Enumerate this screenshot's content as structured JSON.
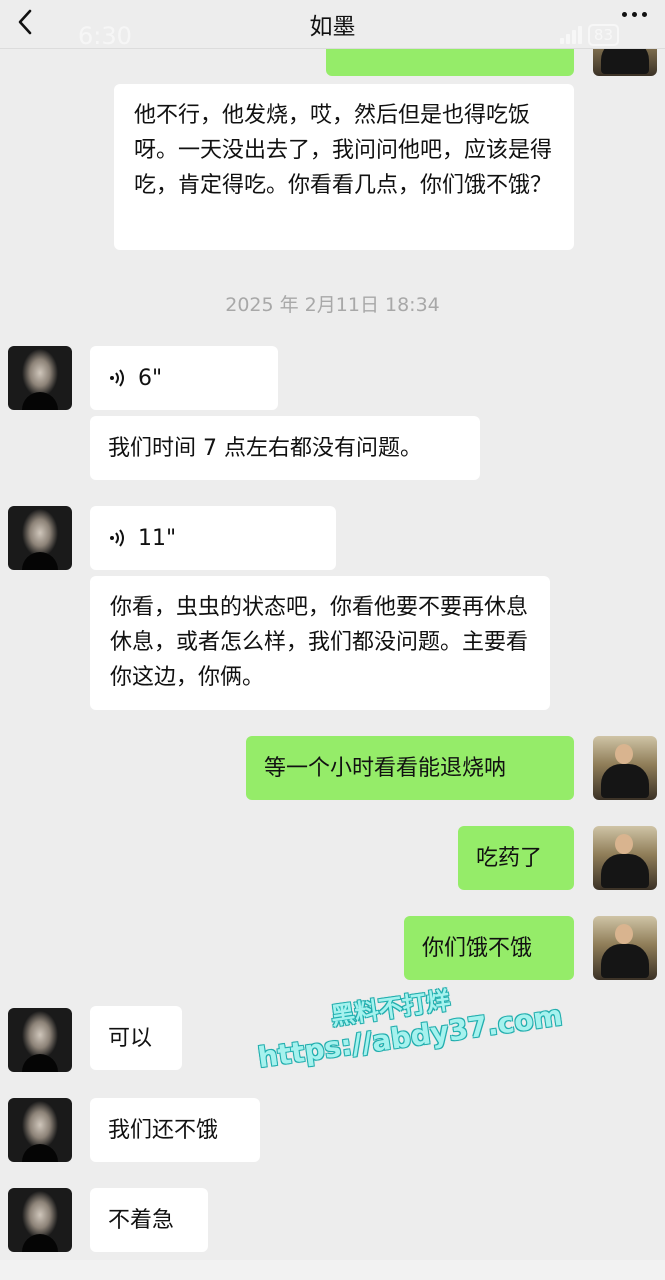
{
  "header": {
    "title": "如墨",
    "ghost_time": "6:30",
    "ghost_battery": "83"
  },
  "messages": {
    "m1": "他不行，他发烧，哎，然后但是也得吃饭呀。一天没出去了，我问问他吧，应该是得吃，肯定得吃。你看看几点，你们饿不饿？",
    "timestamp": "2025 年 2月11日 18:34",
    "voice1_duration": "6\"",
    "m2": "我们时间 7 点左右都没有问题。",
    "voice2_duration": "11\"",
    "m3": "你看，虫虫的状态吧，你看他要不要再休息休息，或者怎么样，我们都没问题。主要看你这边，你俩。",
    "m4": "等一个小时看看能退烧呐",
    "m5": "吃药了",
    "m6": "你们饿不饿",
    "m7": "可以",
    "m8": "我们还不饿",
    "m9": "不着急"
  },
  "watermark": {
    "line1": "黑料不打烊",
    "line2": "https://abdy37.com"
  },
  "colors": {
    "background": "#ededed",
    "bubble_incoming": "#ffffff",
    "bubble_outgoing": "#95ec69",
    "timestamp": "#a8a8a8"
  },
  "icons": [
    "back-arrow-icon",
    "more-icon",
    "voice-wave-icon"
  ]
}
